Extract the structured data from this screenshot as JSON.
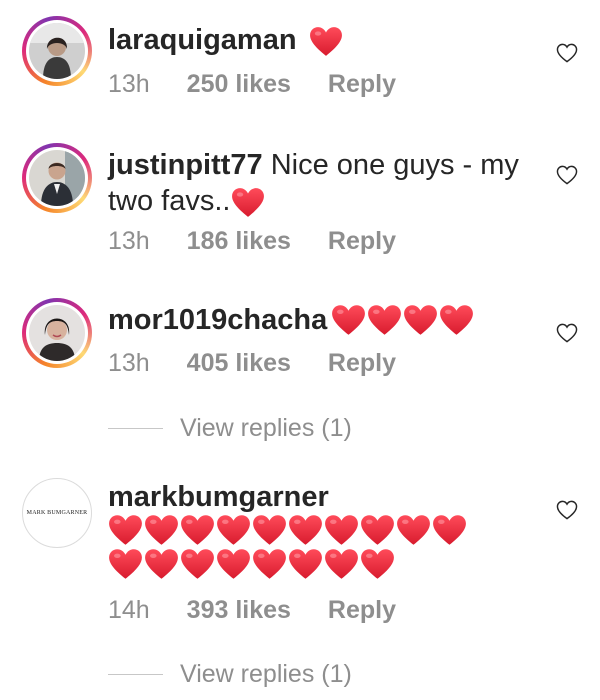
{
  "colors": {
    "heart": "#ed2c3c",
    "meta": "#8e8e8e",
    "text": "#262626"
  },
  "comments": [
    {
      "username": "laraquigaman",
      "text": "",
      "hearts": 1,
      "time": "13h",
      "likes": "250 likes",
      "reply": "Reply"
    },
    {
      "username": "justinpitt77",
      "text_line1": "Nice one guys - my",
      "text_line2": "two favs..",
      "hearts": 1,
      "time": "13h",
      "likes": "186 likes",
      "reply": "Reply"
    },
    {
      "username": "mor1019chacha",
      "text": "",
      "hearts": 4,
      "time": "13h",
      "likes": "405 likes",
      "reply": "Reply",
      "view_replies": "View replies (1)"
    },
    {
      "username": "markbumgarner",
      "avatar_text": "MARK BUMGARNER",
      "text": "",
      "hearts": 18,
      "time": "14h",
      "likes": "393 likes",
      "reply": "Reply",
      "view_replies": "View replies (1)"
    }
  ]
}
